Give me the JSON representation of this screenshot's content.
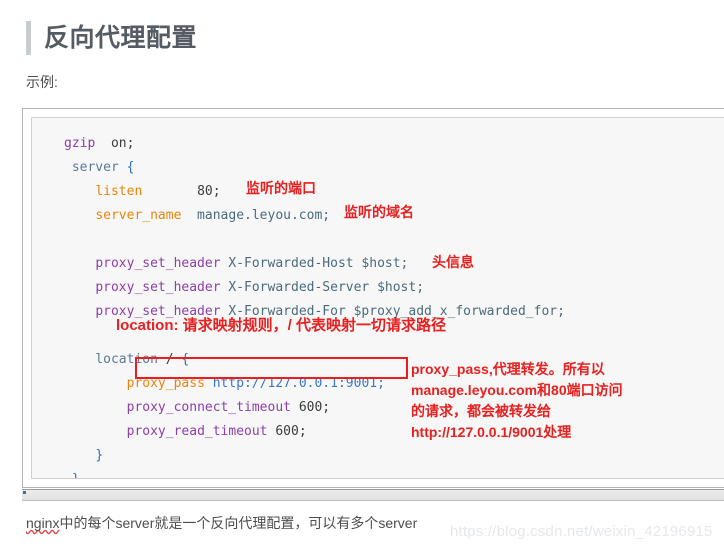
{
  "heading": {
    "title": "反向代理配置"
  },
  "example_label": "示例:",
  "code_block": {
    "lines": [
      {
        "indent": 0,
        "tokens": [
          {
            "t": "gzip",
            "c": "kw"
          },
          {
            "t": "  on;",
            "c": "plain"
          }
        ]
      },
      {
        "indent": 0,
        "tokens": [
          {
            "t": " server",
            "c": "blk"
          },
          {
            "t": " ",
            "c": "plain"
          },
          {
            "t": "{",
            "c": "brace"
          }
        ]
      },
      {
        "indent": 0,
        "tokens": [
          {
            "t": "    ",
            "c": "plain"
          },
          {
            "t": "listen",
            "c": "dir"
          },
          {
            "t": "       80;",
            "c": "plain"
          }
        ]
      },
      {
        "indent": 0,
        "tokens": [
          {
            "t": "    ",
            "c": "plain"
          },
          {
            "t": "server_name",
            "c": "dir"
          },
          {
            "t": "  manage.leyou.com;",
            "c": "val"
          }
        ]
      },
      {
        "indent": 0,
        "tokens": []
      },
      {
        "indent": 0,
        "tokens": [
          {
            "t": "    ",
            "c": "plain"
          },
          {
            "t": "proxy_set_header",
            "c": "kw"
          },
          {
            "t": " X-Forwarded-Host $host;",
            "c": "val"
          }
        ]
      },
      {
        "indent": 0,
        "tokens": [
          {
            "t": "    ",
            "c": "plain"
          },
          {
            "t": "proxy_set_header",
            "c": "kw"
          },
          {
            "t": " X-Forwarded-Server $host;",
            "c": "val"
          }
        ]
      },
      {
        "indent": 0,
        "tokens": [
          {
            "t": "    ",
            "c": "plain"
          },
          {
            "t": "proxy_set_header",
            "c": "kw"
          },
          {
            "t": " X-Forwarded-For $proxy_add_x_forwarded_for;",
            "c": "val"
          }
        ]
      },
      {
        "indent": 0,
        "tokens": []
      },
      {
        "indent": 0,
        "tokens": [
          {
            "t": "    ",
            "c": "plain"
          },
          {
            "t": "location",
            "c": "blk"
          },
          {
            "t": " / ",
            "c": "plain"
          },
          {
            "t": "{",
            "c": "brace"
          }
        ]
      },
      {
        "indent": 0,
        "tokens": [
          {
            "t": "        ",
            "c": "plain"
          },
          {
            "t": "proxy_pass",
            "c": "dir"
          },
          {
            "t": " ",
            "c": "plain"
          },
          {
            "t": "http://127.0.0.1:9001;",
            "c": "url"
          }
        ]
      },
      {
        "indent": 0,
        "tokens": [
          {
            "t": "        ",
            "c": "plain"
          },
          {
            "t": "proxy_connect_timeout",
            "c": "kw"
          },
          {
            "t": " 600;",
            "c": "plain"
          }
        ]
      },
      {
        "indent": 0,
        "tokens": [
          {
            "t": "        ",
            "c": "plain"
          },
          {
            "t": "proxy_read_timeout",
            "c": "kw"
          },
          {
            "t": " 600;",
            "c": "plain"
          }
        ]
      },
      {
        "indent": 0,
        "tokens": [
          {
            "t": "    ",
            "c": "plain"
          },
          {
            "t": "}",
            "c": "brace"
          }
        ]
      },
      {
        "indent": 0,
        "tokens": [
          {
            "t": " ",
            "c": "plain"
          },
          {
            "t": "}",
            "c": "brace"
          }
        ]
      }
    ]
  },
  "annotations": {
    "port": "监听的端口",
    "domain": "监听的域名",
    "header": "头信息",
    "location": "location: 请求映射规则，/ 代表映射一切请求路径",
    "proxy_pass": [
      "proxy_pass,代理转发。所有以",
      "manage.leyou.com和80端口访问",
      "的请求，都会被转发给",
      "http://127.0.0.1/9001处理"
    ]
  },
  "bottom_paragraph": {
    "misspelled_word": "nginx",
    "rest": "中的每个server就是一个反向代理配置，可以有多个server"
  },
  "watermark": "https://blog.csdn.net/weixin_42196915",
  "colors": {
    "annotation_red": "#e8201f",
    "box_red": "#ee1c1c",
    "heading_gray": "#555b63",
    "heading_bar": "#c7ccd1",
    "code_bg": "#f7f7f7",
    "watermark_gray": "#e6e8eb"
  }
}
